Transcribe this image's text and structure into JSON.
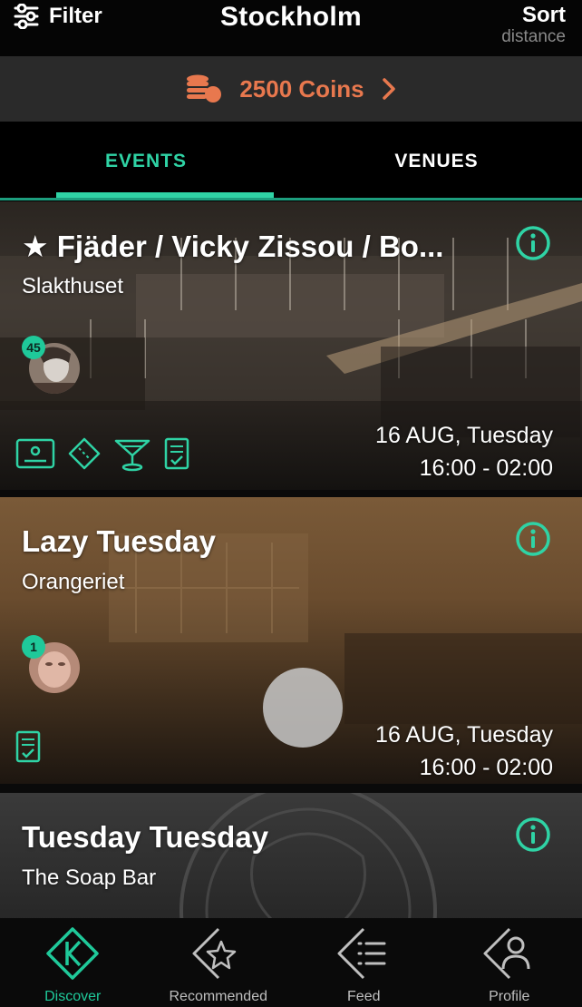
{
  "header": {
    "filter_label": "Filter",
    "city": "Stockholm",
    "sort_label": "Sort",
    "sort_mode": "distance"
  },
  "coins": {
    "text": "2500 Coins",
    "icon": "coins-icon",
    "color": "#e8784e"
  },
  "tabs": [
    {
      "label": "EVENTS",
      "active": true
    },
    {
      "label": "VENUES",
      "active": false
    }
  ],
  "accent_color": "#2fd3a5",
  "events": [
    {
      "title": "★ Fjäder / Vicky Zissou / Bo...",
      "venue": "Slakthuset",
      "attendee_count": "45",
      "date": "16 AUG, Tuesday",
      "time": "16:00 - 02:00",
      "features": [
        "id-card-icon",
        "ticket-icon",
        "cocktail-icon",
        "checklist-icon"
      ]
    },
    {
      "title": "Lazy Tuesday",
      "venue": "Orangeriet",
      "attendee_count": "1",
      "date": "16 AUG, Tuesday",
      "time": "16:00 - 02:00",
      "features": [
        "checklist-icon"
      ]
    },
    {
      "title": "Tuesday Tuesday",
      "venue": "The Soap Bar"
    }
  ],
  "nav": [
    {
      "label": "Discover",
      "icon": "discover-icon",
      "active": true
    },
    {
      "label": "Recommended",
      "icon": "star-icon",
      "active": false
    },
    {
      "label": "Feed",
      "icon": "list-icon",
      "active": false
    },
    {
      "label": "Profile",
      "icon": "user-icon",
      "active": false
    }
  ]
}
